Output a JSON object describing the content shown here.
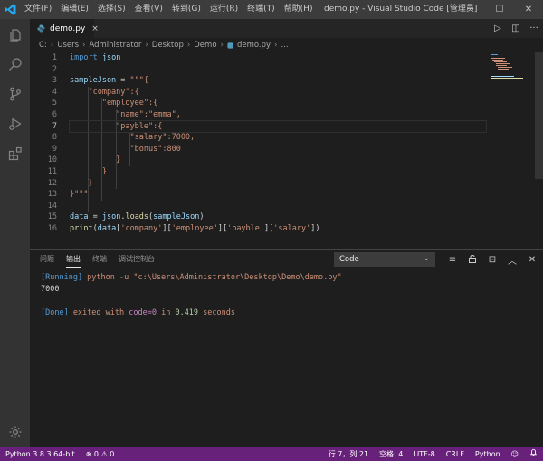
{
  "titlebar": {
    "menus": [
      "文件(F)",
      "编辑(E)",
      "选择(S)",
      "查看(V)",
      "转到(G)",
      "运行(R)",
      "终端(T)",
      "帮助(H)"
    ],
    "window_title": "demo.py - Visual Studio Code [管理员]",
    "controls": {
      "minimize": "─",
      "maximize": "☐",
      "close": "✕"
    }
  },
  "colors": {
    "statusbar": "#68217a",
    "accent": "#007acc",
    "editor_bg": "#1e1e1e"
  },
  "tab": {
    "label": "demo.py",
    "close": "×"
  },
  "tab_actions": {
    "run": "▷",
    "split": "◫",
    "more": "···"
  },
  "breadcrumb": {
    "parts": [
      "C:",
      "Users",
      "Administrator",
      "Desktop",
      "Demo"
    ],
    "file": "demo.py",
    "tail": "..."
  },
  "editor": {
    "line_numbers": [
      "1",
      "2",
      "3",
      "4",
      "5",
      "6",
      "7",
      "8",
      "9",
      "10",
      "11",
      "12",
      "13",
      "14",
      "15",
      "16"
    ],
    "lines": {
      "l1_kw": "import",
      "l1_mod": " json",
      "l3_var": "sampleJson",
      "l3_op": " = ",
      "l3_str": "\"\"\"{",
      "l4": "    \"company\":{",
      "l5": "       \"employee\":{",
      "l6": "          \"name\":\"emma\",",
      "l7a": "          \"payble\":{ ",
      "l8": "             \"salary\":7000,",
      "l9": "             \"bonus\":800",
      "l10": "          }",
      "l11": "       }",
      "l12": "    }",
      "l13": "}\"\"\"",
      "l15_var": "data",
      "l15_op": " = ",
      "l15_mod": "json",
      "l15_dot": ".",
      "l15_fn": "loads",
      "l15_open": "(",
      "l15_arg": "sampleJson",
      "l15_close": ")",
      "l16_fn": "print",
      "l16_open": "(",
      "l16_var": "data",
      "l16_k1": "'company'",
      "l16_k2": "'employee'",
      "l16_k3": "'payble'",
      "l16_k4": "'salary'",
      "l16_close": ")"
    }
  },
  "panel": {
    "tabs": [
      "问题",
      "输出",
      "终端",
      "调试控制台"
    ],
    "active_tab": "输出",
    "output_channel": "Code",
    "actions": {
      "filter": "≡",
      "lock": "🔓",
      "clear": "⊟",
      "maximize": "︿",
      "close": "✕"
    },
    "output": {
      "running_tag": "[Running]",
      "command": " python -u \"c:\\Users\\Administrator\\Desktop\\Demo\\demo.py\"",
      "result": "7000",
      "done_tag": "[Done]",
      "exit_text": " exited with ",
      "exit_code": "code=0",
      "in_text": " in ",
      "duration": "0.419",
      "seconds": " seconds"
    }
  },
  "statusbar": {
    "python": "Python 3.8.3 64-bit",
    "problems": "⊗ 0 ⚠ 0",
    "position": "行 7，列 21",
    "spaces": "空格: 4",
    "encoding": "UTF-8",
    "eol": "CRLF",
    "language": "Python",
    "feedback": "☺",
    "bell": "🔔"
  }
}
